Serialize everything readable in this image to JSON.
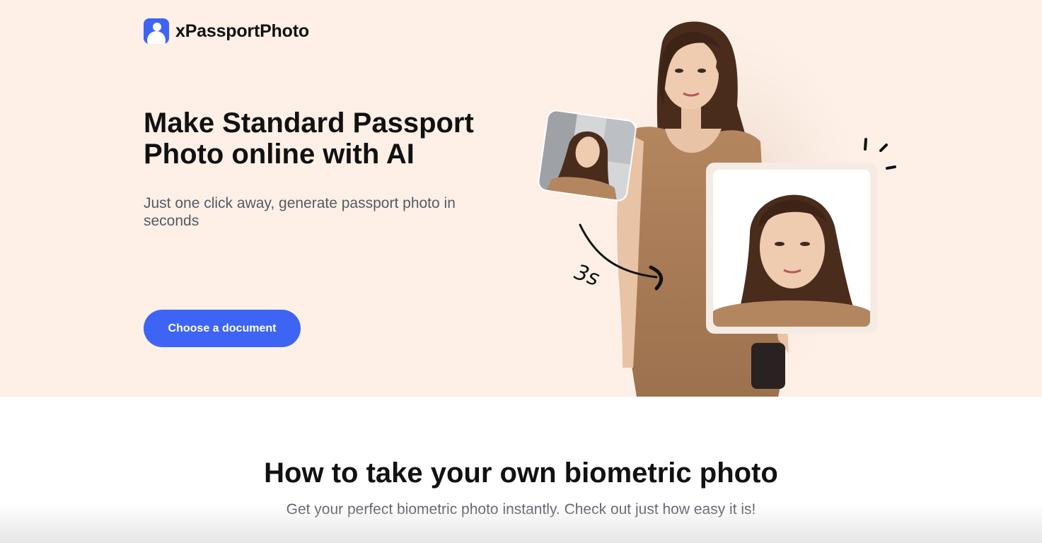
{
  "brand": {
    "name": "xPassportPhoto",
    "logo_icon": "person-icon",
    "color": "#3d64f4"
  },
  "hero": {
    "background": "#fef0e7",
    "title": "Make Standard Passport Photo online with AI",
    "subtitle": "Just one click away, generate passport photo in seconds",
    "cta_label": "Choose a document",
    "cta_color": "#3d64f4",
    "speed_label": "3s"
  },
  "how_to": {
    "title": "How to take your own biometric photo",
    "subtitle": "Get your perfect biometric photo instantly. Check out just how easy it is!"
  }
}
